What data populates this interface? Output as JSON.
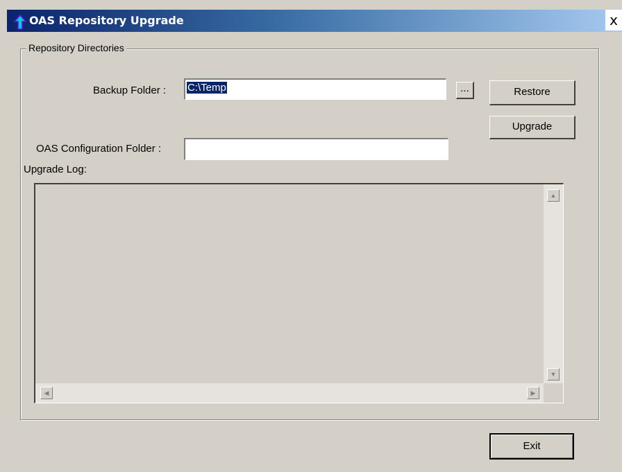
{
  "window": {
    "title": "OAS Repository Upgrade",
    "close_glyph": "x",
    "icon": "app-arrow-icon",
    "titlebar_colors": [
      "#0a246a",
      "#a6caf0"
    ]
  },
  "group": {
    "label": "Repository Directories"
  },
  "backup": {
    "label": "Backup Folder :",
    "value": "C:\\Temp",
    "browse_label": "..."
  },
  "config": {
    "label": "OAS Configuration Folder :",
    "value": ""
  },
  "buttons": {
    "restore": "Restore",
    "upgrade": "Upgrade",
    "exit": "Exit"
  },
  "log": {
    "label": "Upgrade Log:"
  },
  "scroll": {
    "up": "▲",
    "down": "▼",
    "left": "◀",
    "right": "▶"
  }
}
